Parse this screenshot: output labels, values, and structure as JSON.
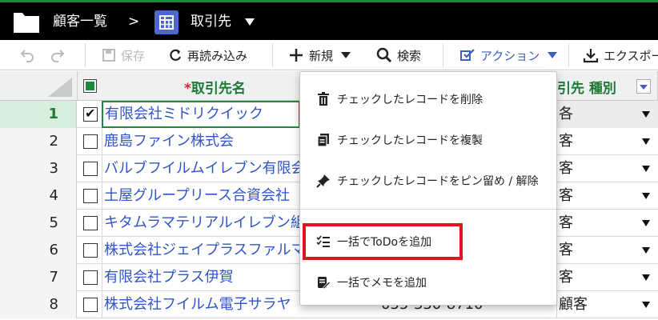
{
  "header": {
    "breadcrumb_home": "顧客一覧",
    "separator": ">",
    "current": "取引先"
  },
  "toolbar": {
    "save": "保存",
    "reload": "再読み込み",
    "new": "新規",
    "search": "検索",
    "action": "アクション",
    "export": "エクスポー"
  },
  "grid": {
    "col_name_required": "*",
    "col_name": "取引先名",
    "col_type": "引先 種別",
    "rows": [
      {
        "num": "1",
        "name": "有限会社ミドリクイック",
        "type": "各",
        "checked": true
      },
      {
        "num": "2",
        "name": "鹿島ファイン株式会",
        "type": "客",
        "checked": false
      },
      {
        "num": "3",
        "name": "バルブフイルムイレブン有限会",
        "type": "客",
        "checked": false
      },
      {
        "num": "4",
        "name": "土屋グループリース合資会社",
        "type": "客",
        "checked": false
      },
      {
        "num": "5",
        "name": "キタムラマテリアルイレブン組合",
        "type": "客",
        "checked": false
      },
      {
        "num": "6",
        "name": "株式会社ジェイプラスファルマ",
        "type": "客",
        "checked": false
      },
      {
        "num": "7",
        "name": "有限会社プラス伊賀",
        "type": "客",
        "checked": false
      },
      {
        "num": "8",
        "name": "株式会社フイルム電子サラヤ",
        "type": "顧客",
        "phone": "055-330-8710",
        "checked": false
      }
    ]
  },
  "menu": {
    "items": [
      {
        "label": "チェックしたレコードを削除",
        "icon": "trash-icon"
      },
      {
        "label": "チェックしたレコードを複製",
        "icon": "copy-icon"
      },
      {
        "label": "チェックしたレコードをピン留め / 解除",
        "icon": "pin-icon"
      },
      {
        "label": "一括でToDoを追加",
        "icon": "todo-list-icon"
      },
      {
        "label": "一括でメモを追加",
        "icon": "memo-icon"
      }
    ]
  },
  "colors": {
    "accent_green": "#1f8a3c",
    "link_blue": "#2f55c9",
    "highlight_red": "#e0131e"
  }
}
